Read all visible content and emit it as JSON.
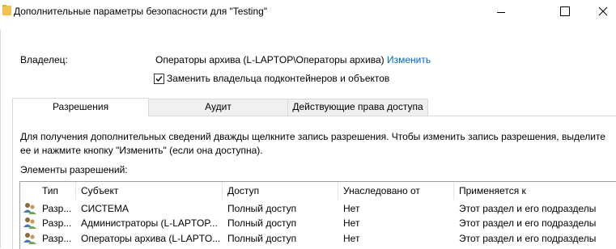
{
  "window": {
    "title": "Дополнительные параметры безопасности  для \"Testing\""
  },
  "owner": {
    "label": "Владелец:",
    "value": "Операторы архива (L-LAPTOP\\Операторы архива)",
    "change_link": "Изменить",
    "replace_checkbox": {
      "label": "Заменить владельца подконтейнеров и объектов",
      "checked": true
    }
  },
  "tabs": [
    {
      "label": "Разрешения",
      "active": true
    },
    {
      "label": "Аудит",
      "active": false
    },
    {
      "label": "Действующие права доступа",
      "active": false
    }
  ],
  "info_text": {
    "line1": "Для получения дополнительных сведений дважды щелкните запись разрешения. Чтобы изменить запись разрешения, выделите",
    "line2": "ее и нажмите кнопку \"Изменить\" (если она доступна)."
  },
  "entries_label": "Элементы разрешений:",
  "table": {
    "columns": [
      "Тип",
      "Субъект",
      "Доступ",
      "Унаследовано от",
      "Применяется к"
    ],
    "rows": [
      {
        "type": "Разр...",
        "subject": "СИСТЕМА",
        "access": "Полный доступ",
        "inherited": "Нет",
        "applies": "Этот раздел и его подразделы"
      },
      {
        "type": "Разр...",
        "subject": "Администраторы (L-LAPTOP...",
        "access": "Полный доступ",
        "inherited": "Нет",
        "applies": "Этот раздел и его подразделы"
      },
      {
        "type": "Разр...",
        "subject": "Операторы архива (L-LAPTO...",
        "access": "Полный доступ",
        "inherited": "Нет",
        "applies": "Этот раздел и его подразделы"
      }
    ]
  },
  "colors": {
    "link": "#0066cc",
    "folder": "#f4c24a",
    "border": "#a0a0a0"
  },
  "icons": {
    "folder": "folder-icon",
    "minimize": "minimize-icon",
    "maximize": "maximize-icon",
    "close": "close-icon",
    "user": "user-group-icon",
    "check": "checkmark-icon"
  }
}
